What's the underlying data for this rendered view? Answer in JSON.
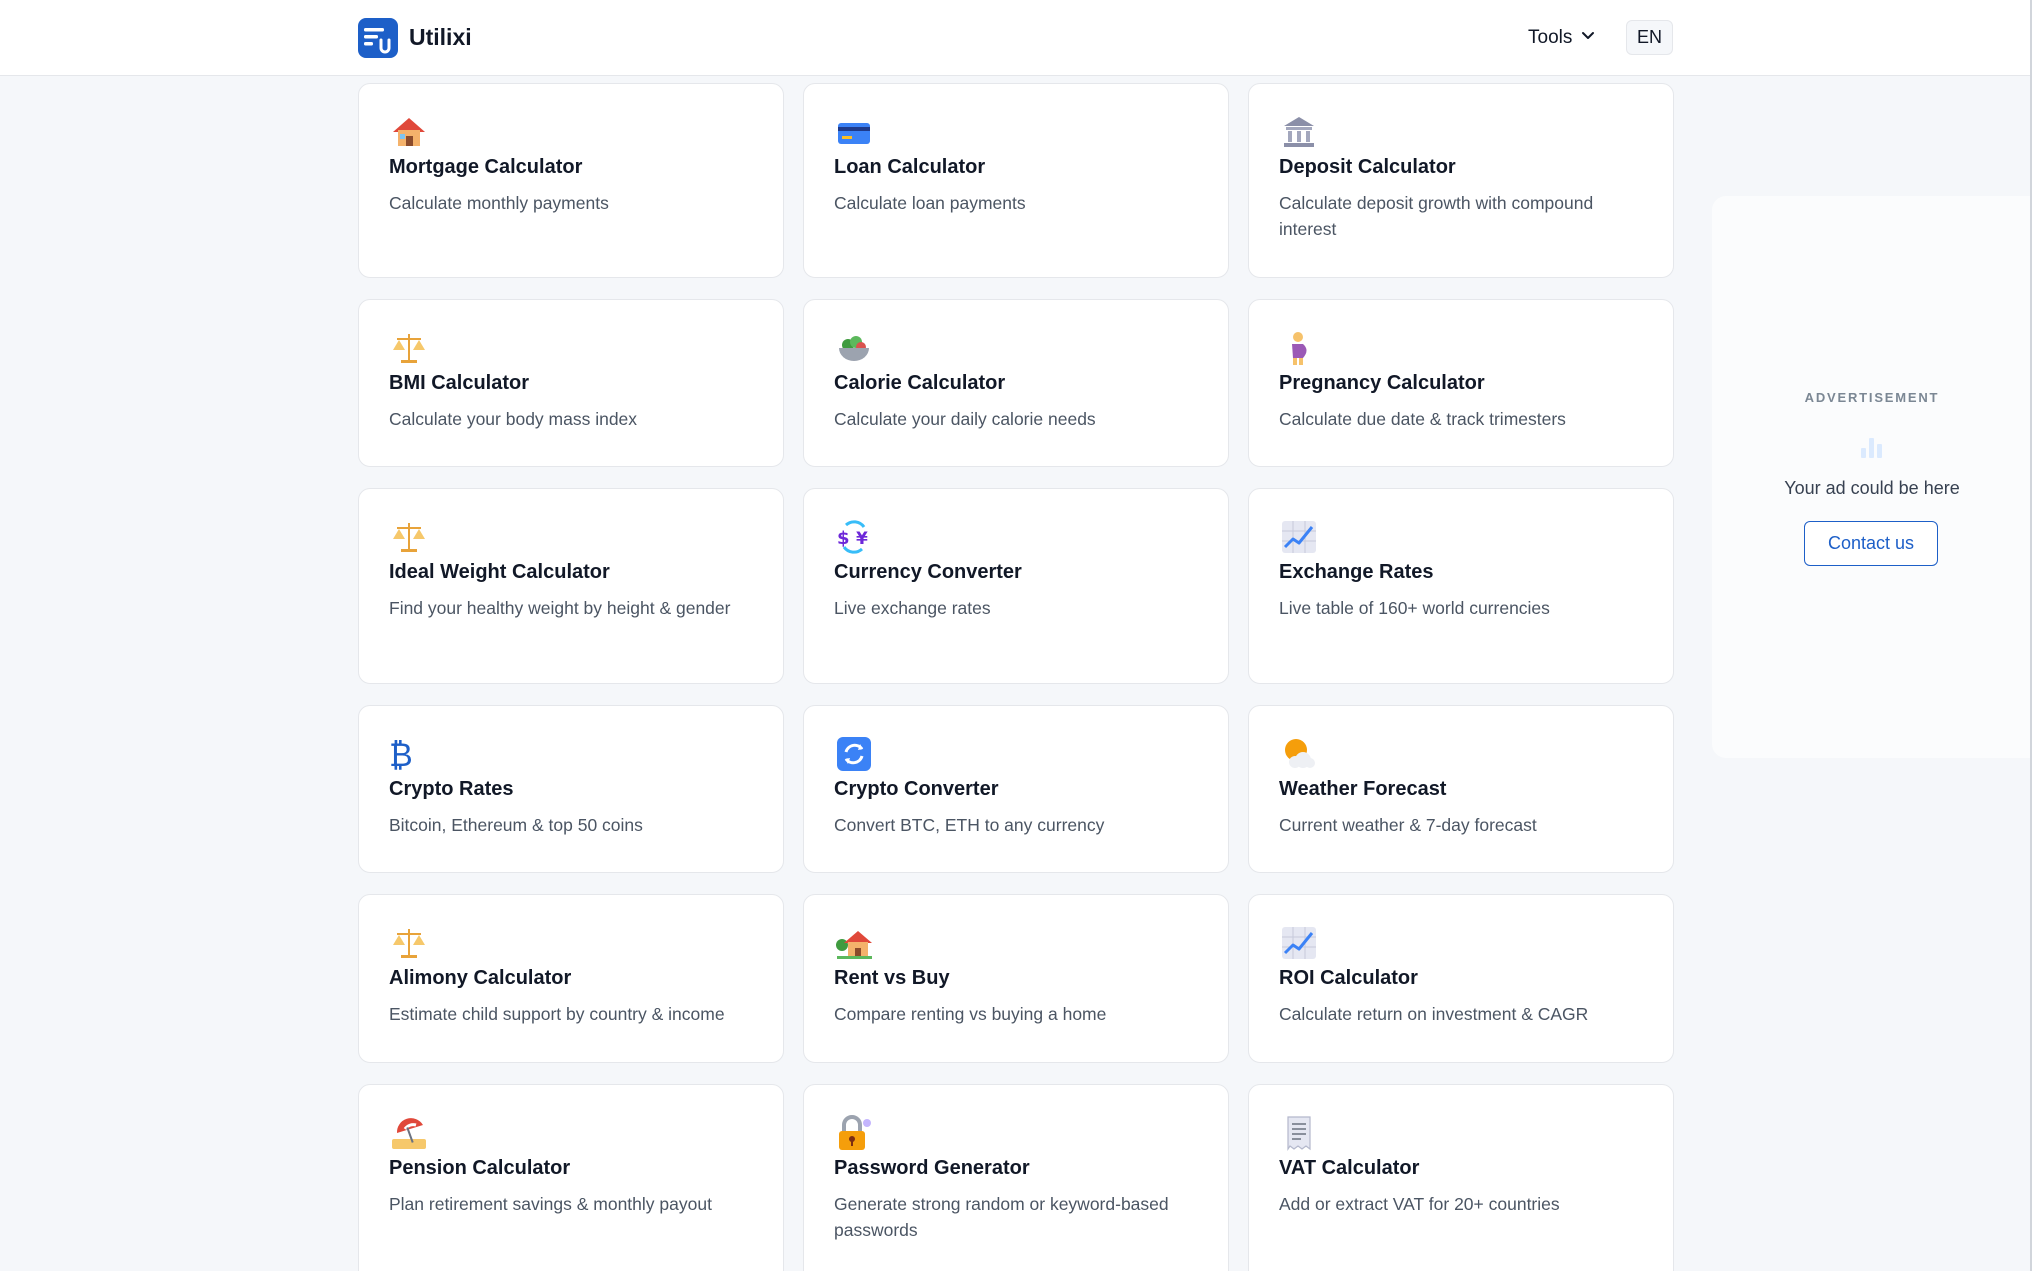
{
  "header": {
    "brand": "Utilixi",
    "tools_label": "Tools",
    "lang": "EN"
  },
  "cards": [
    {
      "icon": "house-icon",
      "title": "Mortgage Calculator",
      "desc": "Calculate monthly payments"
    },
    {
      "icon": "credit-card-icon",
      "title": "Loan Calculator",
      "desc": "Calculate loan payments"
    },
    {
      "icon": "bank-icon",
      "title": "Deposit Calculator",
      "desc": "Calculate deposit growth with compound interest"
    },
    {
      "icon": "scales-icon",
      "title": "BMI Calculator",
      "desc": "Calculate your body mass index"
    },
    {
      "icon": "salad-bowl-icon",
      "title": "Calorie Calculator",
      "desc": "Calculate your daily calorie needs"
    },
    {
      "icon": "pregnant-woman-icon",
      "title": "Pregnancy Calculator",
      "desc": "Calculate due date & track trimesters"
    },
    {
      "icon": "scales-icon",
      "title": "Ideal Weight Calculator",
      "desc": "Find your healthy weight by height & gender"
    },
    {
      "icon": "currency-exchange-icon",
      "title": "Currency Converter",
      "desc": "Live exchange rates"
    },
    {
      "icon": "chart-increasing-icon",
      "title": "Exchange Rates",
      "desc": "Live table of 160+ world currencies"
    },
    {
      "icon": "bitcoin-icon",
      "title": "Crypto Rates",
      "desc": "Bitcoin, Ethereum & top 50 coins"
    },
    {
      "icon": "refresh-arrows-icon",
      "title": "Crypto Converter",
      "desc": "Convert BTC, ETH to any currency"
    },
    {
      "icon": "sun-behind-cloud-icon",
      "title": "Weather Forecast",
      "desc": "Current weather & 7-day forecast"
    },
    {
      "icon": "scales-icon",
      "title": "Alimony Calculator",
      "desc": "Estimate child support by country & income"
    },
    {
      "icon": "house-with-garden-icon",
      "title": "Rent vs Buy",
      "desc": "Compare renting vs buying a home"
    },
    {
      "icon": "chart-increasing-icon",
      "title": "ROI Calculator",
      "desc": "Calculate return on investment & CAGR"
    },
    {
      "icon": "beach-umbrella-icon",
      "title": "Pension Calculator",
      "desc": "Plan retirement savings & monthly payout"
    },
    {
      "icon": "locked-with-key-icon",
      "title": "Password Generator",
      "desc": "Generate strong random or keyword-based passwords"
    },
    {
      "icon": "receipt-icon",
      "title": "VAT Calculator",
      "desc": "Add or extract VAT for 20+ countries"
    }
  ],
  "ad": {
    "label": "ADVERTISEMENT",
    "text": "Your ad could be here",
    "button": "Contact us"
  },
  "colors": {
    "brand": "#1d5fc8",
    "page_bg": "#f5f7fa",
    "card_border": "#e5e7eb"
  }
}
